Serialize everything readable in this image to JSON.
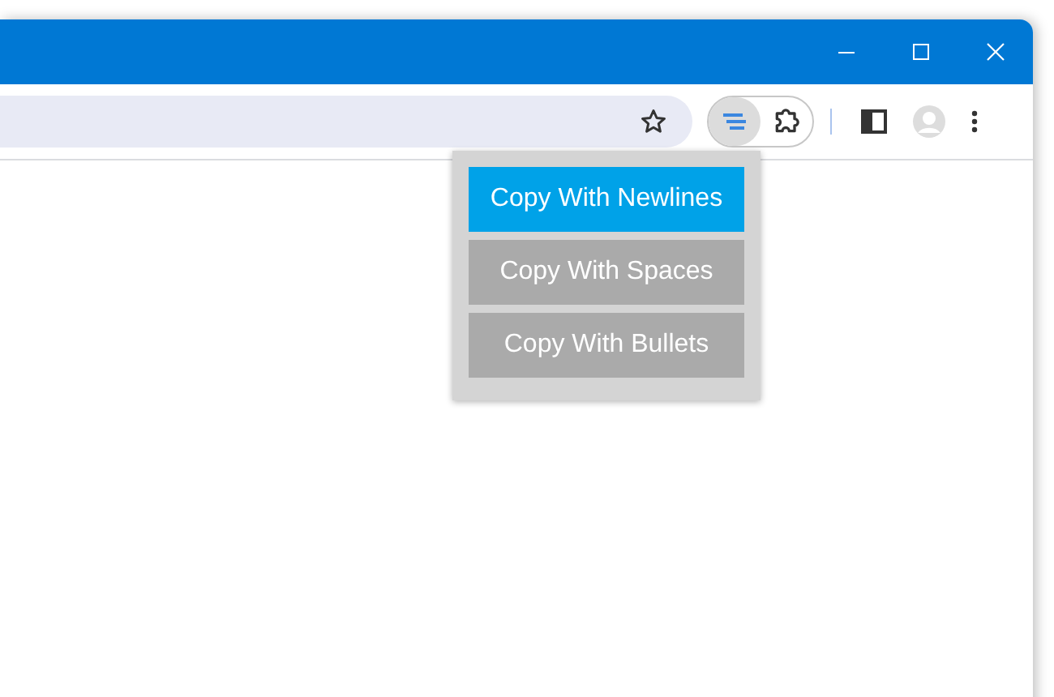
{
  "toolbar": {
    "extension_active": true
  },
  "popup": {
    "options": [
      {
        "label": "Copy With Newlines",
        "selected": true
      },
      {
        "label": "Copy With Spaces",
        "selected": false
      },
      {
        "label": "Copy With Bullets",
        "selected": false
      }
    ]
  }
}
